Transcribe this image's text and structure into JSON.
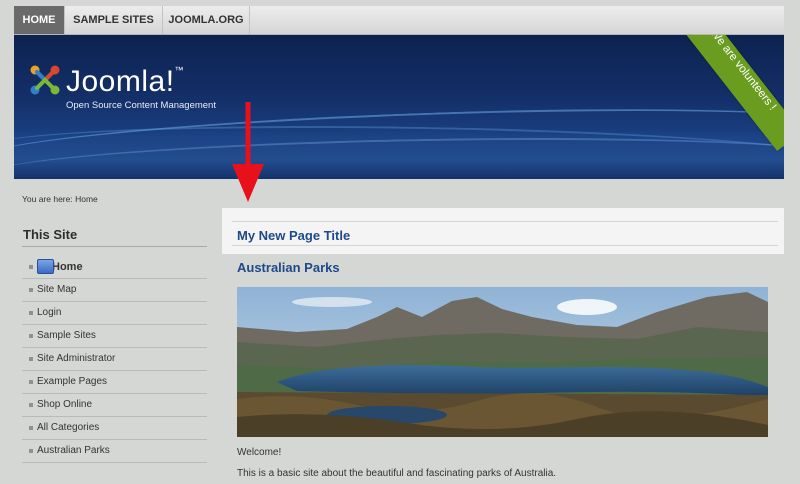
{
  "nav": {
    "tabs": [
      {
        "label": "HOME",
        "active": true
      },
      {
        "label": "SAMPLE SITES",
        "active": false
      },
      {
        "label": "JOOMLA.ORG",
        "active": false
      }
    ]
  },
  "header": {
    "logo_text": "Joomla!",
    "trademark": "™",
    "tagline": "Open Source Content Management",
    "ribbon": "We are volunteers !"
  },
  "breadcrumb": "You are here: Home",
  "sidebar": {
    "title": "This Site",
    "items": [
      {
        "label": "Home"
      },
      {
        "label": "Site Map"
      },
      {
        "label": "Login"
      },
      {
        "label": "Sample Sites"
      },
      {
        "label": "Site Administrator"
      },
      {
        "label": "Example Pages"
      },
      {
        "label": "Shop Online"
      },
      {
        "label": "All Categories"
      },
      {
        "label": "Australian Parks"
      }
    ]
  },
  "main": {
    "page_title": "My New Page Title",
    "article_title": "Australian Parks",
    "welcome": "Welcome!",
    "intro": "This is a basic site about the beautiful and fascinating parks of Australia."
  },
  "colors": {
    "accent": "#1e4a8a",
    "ribbon": "#6a9d1f",
    "annotation_arrow": "#e8101a"
  }
}
